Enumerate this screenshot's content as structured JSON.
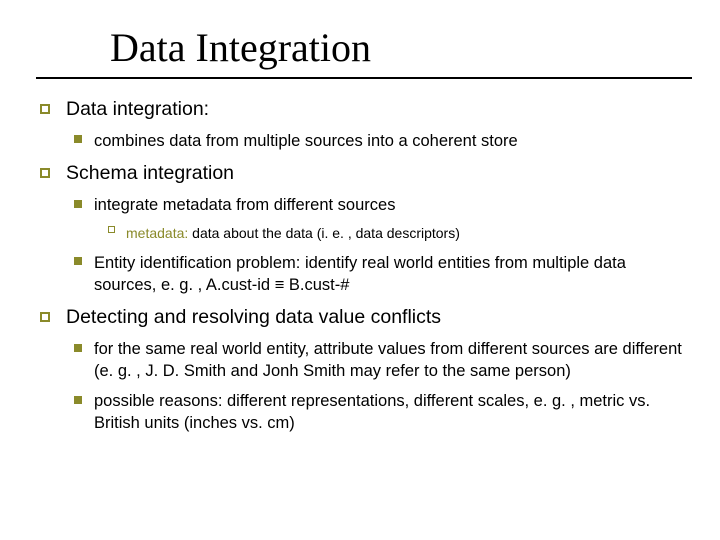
{
  "title": "Data Integration",
  "items": {
    "data_integration": {
      "heading": "Data integration:",
      "sub1": "combines data from multiple sources into a coherent store"
    },
    "schema_integration": {
      "heading": "Schema integration",
      "sub1": "integrate metadata from different sources",
      "sub1_detail_key": "metadata:",
      "sub1_detail_rest": " data about the data (i. e. , data descriptors)",
      "sub2": "Entity identification problem: identify real world entities from multiple data sources, e. g. , A.cust-id ≡ B.cust-#"
    },
    "resolving_conflicts": {
      "heading": "Detecting and resolving data value conflicts",
      "sub1": "for the same real world entity, attribute values from different sources are different (e. g. , J. D. Smith and Jonh Smith may refer to the same person)",
      "sub2": "possible reasons: different representations, different scales, e. g. , metric vs. British units (inches vs. cm)"
    }
  },
  "colors": {
    "accent": "#8a8a2a"
  }
}
